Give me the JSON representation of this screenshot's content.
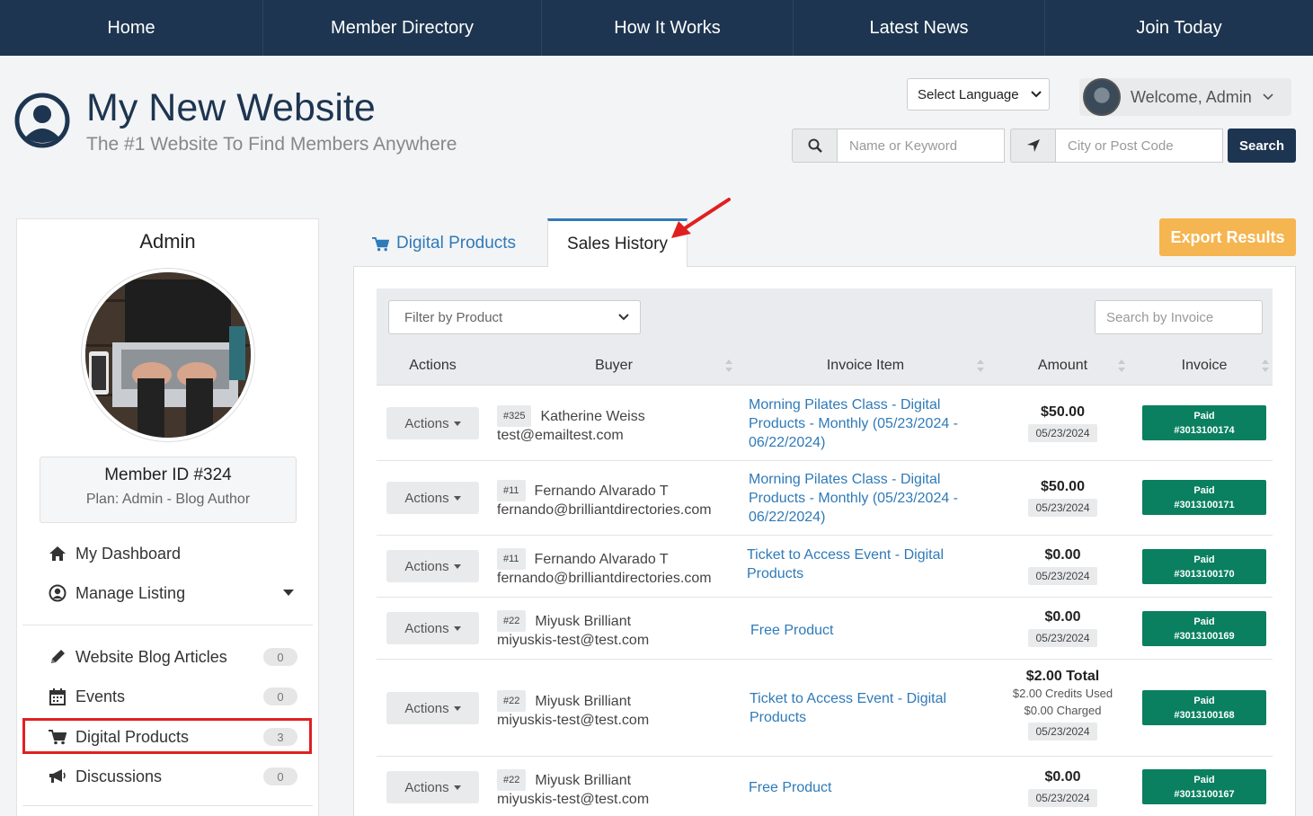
{
  "nav": [
    "Home",
    "Member Directory",
    "How It Works",
    "Latest News",
    "Join Today"
  ],
  "site": {
    "title": "My New Website",
    "tagline": "The #1 Website To Find Members Anywhere"
  },
  "header": {
    "language_label": "Select Language",
    "welcome": "Welcome, Admin",
    "keyword_placeholder": "Name or Keyword",
    "location_placeholder": "City or Post Code",
    "search_label": "Search"
  },
  "sidebar": {
    "name": "Admin",
    "member_id": "Member ID #324",
    "plan": "Plan: Admin - Blog Author",
    "menu": [
      {
        "label": "My Dashboard",
        "icon": "home-icon"
      },
      {
        "label": "Manage Listing",
        "icon": "user-circle-icon"
      }
    ],
    "features": [
      {
        "label": "Website Blog Articles",
        "count": "0",
        "icon": "pencil-icon"
      },
      {
        "label": "Events",
        "count": "0",
        "icon": "calendar-icon"
      },
      {
        "label": "Digital Products",
        "count": "3",
        "icon": "cart-icon"
      },
      {
        "label": "Discussions",
        "count": "0",
        "icon": "megaphone-icon"
      }
    ]
  },
  "tabs": {
    "digital_products": "Digital Products",
    "sales_history": "Sales History"
  },
  "export_label": "Export Results",
  "filters": {
    "product_placeholder": "Filter by Product",
    "invoice_placeholder": "Search by Invoice"
  },
  "table": {
    "headers": [
      "Actions",
      "Buyer",
      "Invoice Item",
      "Amount",
      "Invoice"
    ],
    "actions_label": "Actions",
    "rows": [
      {
        "num": "#325",
        "name": "Katherine Weiss",
        "email": "test@emailtest.com",
        "item": "Morning Pilates Class - Digital Products - Monthly (05/23/2024 - 06/22/2024)",
        "amount": "$50.00",
        "sub1": "",
        "sub2": "",
        "date": "05/23/2024",
        "status": "Paid",
        "invoice": "#3013100174"
      },
      {
        "num": "#11",
        "name": "Fernando Alvarado T",
        "email": "fernando@brilliantdirectories.com",
        "item": "Morning Pilates Class - Digital Products - Monthly (05/23/2024 - 06/22/2024)",
        "amount": "$50.00",
        "sub1": "",
        "sub2": "",
        "date": "05/23/2024",
        "status": "Paid",
        "invoice": "#3013100171"
      },
      {
        "num": "#11",
        "name": "Fernando Alvarado T",
        "email": "fernando@brilliantdirectories.com",
        "item": "Ticket to Access Event - Digital Products",
        "amount": "$0.00",
        "sub1": "",
        "sub2": "",
        "date": "05/23/2024",
        "status": "Paid",
        "invoice": "#3013100170"
      },
      {
        "num": "#22",
        "name": "Miyusk Brilliant",
        "email": "miyuskis-test@test.com",
        "item": "Free Product",
        "amount": "$0.00",
        "sub1": "",
        "sub2": "",
        "date": "05/23/2024",
        "status": "Paid",
        "invoice": "#3013100169"
      },
      {
        "num": "#22",
        "name": "Miyusk Brilliant",
        "email": "miyuskis-test@test.com",
        "item": "Ticket to Access Event - Digital Products",
        "amount": "$2.00 Total",
        "sub1": "$2.00 Credits Used",
        "sub2": "$0.00 Charged",
        "date": "05/23/2024",
        "status": "Paid",
        "invoice": "#3013100168"
      },
      {
        "num": "#22",
        "name": "Miyusk Brilliant",
        "email": "miyuskis-test@test.com",
        "item": "Free Product",
        "amount": "$0.00",
        "sub1": "",
        "sub2": "",
        "date": "05/23/2024",
        "status": "Paid",
        "invoice": "#3013100167"
      }
    ]
  },
  "colors": {
    "navy": "#1d3550",
    "link": "#2f7ab8",
    "paid": "#0a8060",
    "export": "#f5b550",
    "highlight": "#e02020"
  }
}
